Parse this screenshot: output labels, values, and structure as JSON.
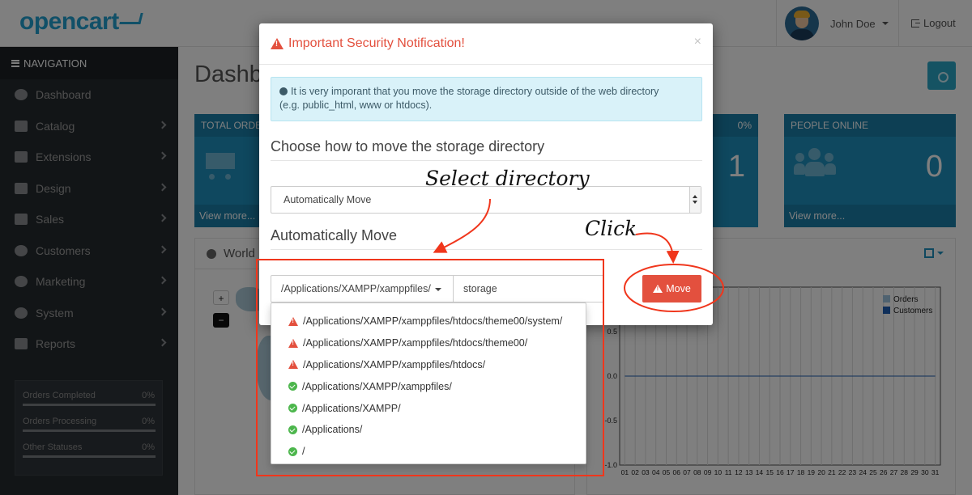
{
  "header": {
    "logo": "opencart",
    "user_name": "John Doe",
    "logout_label": "Logout"
  },
  "sidebar": {
    "heading": "NAVIGATION",
    "items": [
      {
        "label": "Dashboard",
        "icon": "dashboard-icon"
      },
      {
        "label": "Catalog",
        "icon": "tags-icon"
      },
      {
        "label": "Extensions",
        "icon": "puzzle-icon"
      },
      {
        "label": "Design",
        "icon": "monitor-icon"
      },
      {
        "label": "Sales",
        "icon": "cart-icon"
      },
      {
        "label": "Customers",
        "icon": "user-icon"
      },
      {
        "label": "Marketing",
        "icon": "share-icon"
      },
      {
        "label": "System",
        "icon": "gear-icon"
      },
      {
        "label": "Reports",
        "icon": "bar-chart-icon"
      }
    ],
    "stats": [
      {
        "label": "Orders Completed",
        "value": "0%"
      },
      {
        "label": "Orders Processing",
        "value": "0%"
      },
      {
        "label": "Other Statuses",
        "value": "0%"
      }
    ]
  },
  "dashboard": {
    "title": "Dashb",
    "tiles": [
      {
        "title": "TOTAL ORDE",
        "value": "",
        "footer": "View more..."
      },
      {
        "title": "",
        "pct": "0%",
        "value": "1",
        "footer": ""
      },
      {
        "title": "PEOPLE ONLINE",
        "value": "0",
        "footer": "View more..."
      }
    ],
    "world_panel_title": "World",
    "chart_legend": [
      "Orders",
      "Customers"
    ]
  },
  "chart_data": {
    "type": "line",
    "x": [
      "01",
      "02",
      "03",
      "04",
      "05",
      "06",
      "07",
      "08",
      "09",
      "10",
      "11",
      "12",
      "13",
      "14",
      "15",
      "16",
      "17",
      "18",
      "19",
      "20",
      "21",
      "22",
      "23",
      "24",
      "25",
      "26",
      "27",
      "28",
      "29",
      "30",
      "31"
    ],
    "series": [
      {
        "name": "Orders",
        "values": [
          0,
          0,
          0,
          0,
          0,
          0,
          0,
          0,
          0,
          0,
          0,
          0,
          0,
          0,
          0,
          0,
          0,
          0,
          0,
          0,
          0,
          0,
          0,
          0,
          0,
          0,
          0,
          0,
          0,
          0,
          0
        ]
      },
      {
        "name": "Customers",
        "values": [
          0,
          0,
          0,
          0,
          0,
          0,
          0,
          0,
          0,
          0,
          0,
          0,
          0,
          0,
          0,
          0,
          0,
          0,
          0,
          0,
          0,
          0,
          0,
          0,
          0,
          0,
          0,
          0,
          0,
          0,
          0
        ]
      }
    ],
    "yticks": [
      "0.5",
      "0.0",
      "-0.5",
      "-1.0"
    ],
    "ylim": [
      -1.0,
      1.0
    ]
  },
  "modal": {
    "title": "Important Security Notification!",
    "alert_line1": "It is very imporant that you move the storage directory outside of the web directory",
    "alert_line2": "(e.g. public_html, www or htdocs).",
    "choose_heading": "Choose how to move the storage directory",
    "select_value": "Automatically Move",
    "auto_heading": "Automatically Move",
    "dir_button": "/Applications/XAMPP/xamppfiles/",
    "dir_input_value": "storage",
    "move_button": "Move",
    "close_label": "×"
  },
  "dropdown": [
    {
      "path": "/Applications/XAMPP/xamppfiles/htdocs/theme00/system/",
      "status": "warning"
    },
    {
      "path": "/Applications/XAMPP/xamppfiles/htdocs/theme00/",
      "status": "warning"
    },
    {
      "path": "/Applications/XAMPP/xamppfiles/htdocs/",
      "status": "warning"
    },
    {
      "path": "/Applications/XAMPP/xamppfiles/",
      "status": "ok"
    },
    {
      "path": "/Applications/XAMPP/",
      "status": "ok"
    },
    {
      "path": "/Applications/",
      "status": "ok"
    },
    {
      "path": "/",
      "status": "ok"
    }
  ],
  "annotations": {
    "select_directory": "Select directory",
    "click": "Click"
  },
  "colors": {
    "brand": "#23a1d1",
    "danger": "#e3503e",
    "success": "#4cb64c",
    "sidebar_bg": "#252a2e",
    "annotation_red": "#f0361c"
  }
}
